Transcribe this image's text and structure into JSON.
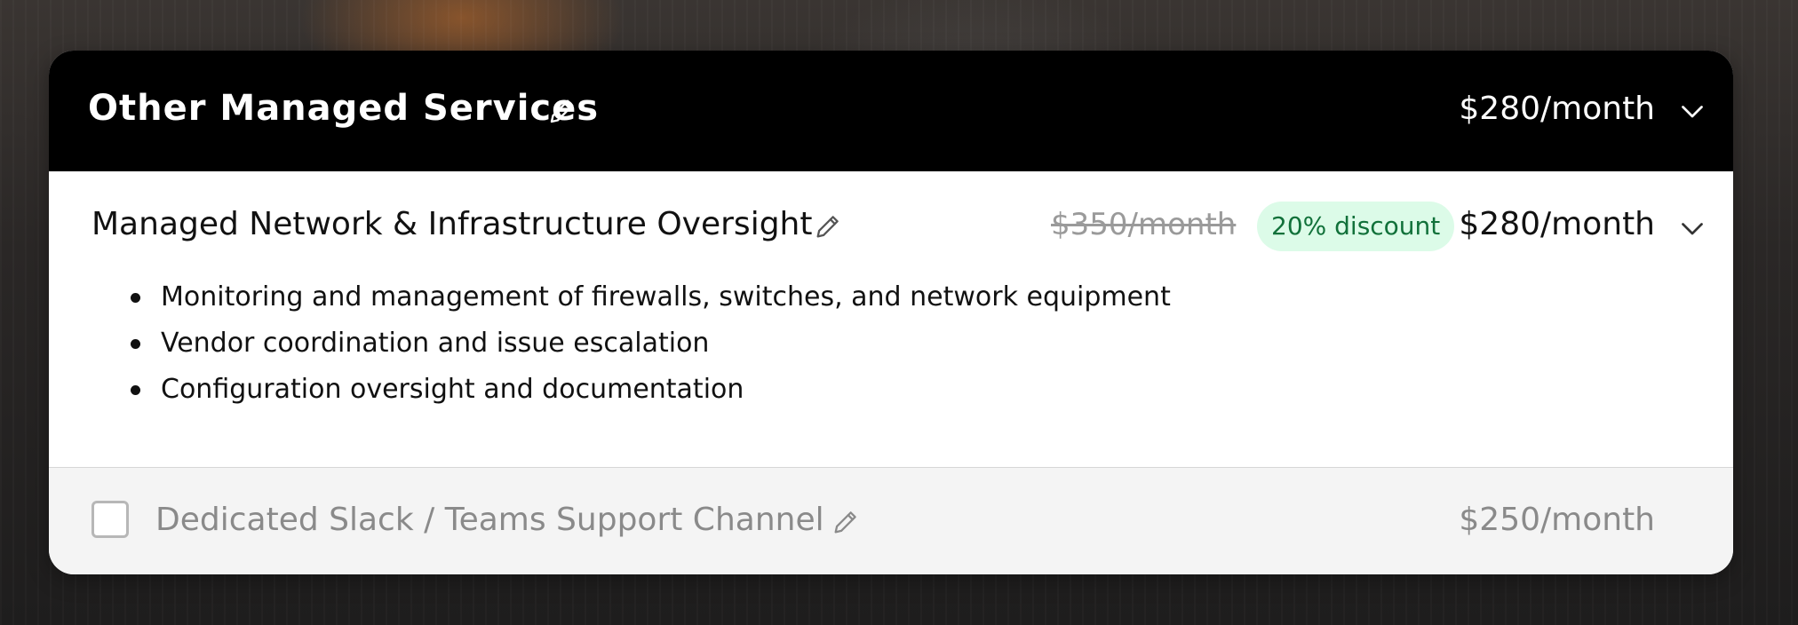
{
  "section": {
    "title": "Other Managed Services",
    "total_price": "$280/month"
  },
  "items": [
    {
      "title": "Managed Network & Infrastructure Oversight",
      "original_price": "$350/month",
      "discount_label": "20% discount",
      "price": "$280/month",
      "expanded": true,
      "features": [
        "Monitoring and management of firewalls, switches, and network equipment",
        "Vendor coordination and issue escalation",
        "Configuration oversight and documentation"
      ]
    },
    {
      "title": "Dedicated Slack / Teams Support Channel",
      "price": "$250/month",
      "selected": false
    }
  ],
  "icons": {
    "edit": "pencil-icon",
    "expand": "chevron-down-icon"
  },
  "colors": {
    "header_bg": "#000000",
    "discount_bg": "#dcfbe8",
    "discount_text": "#11713a",
    "muted_text": "#8a8a8a"
  }
}
